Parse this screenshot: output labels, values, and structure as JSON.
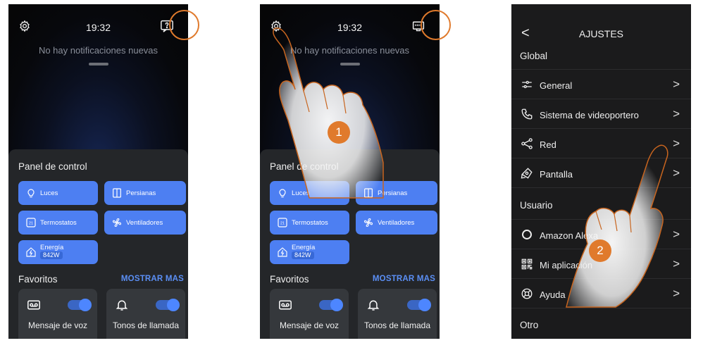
{
  "screen": {
    "time": "19:32",
    "notifications": "No hay notificaciones nuevas",
    "panel_title": "Panel de control",
    "tiles": {
      "lights": "Luces",
      "blinds": "Persianas",
      "thermostats": "Termostatos",
      "fans": "Ventiladores",
      "energy": "Energía",
      "energy_value": "842W"
    },
    "favorites_title": "Favoritos",
    "show_more": "MOSTRAR MAS",
    "favorites": {
      "voice_message": "Mensaje de voz",
      "ringtones": "Tonos de llamada"
    }
  },
  "steps": {
    "one": "1",
    "two": "2"
  },
  "settings": {
    "title": "AJUSTES",
    "back": "<",
    "sections": {
      "global": "Global",
      "user": "Usuario",
      "other": "Otro"
    },
    "items": {
      "general": "General",
      "intercom": "Sistema de videoportero",
      "network": "Red",
      "display": "Pantalla",
      "alexa": "Amazon Alexa",
      "myapp": "Mi aplicación",
      "help": "Ayuda"
    },
    "chevron": ">"
  },
  "colors": {
    "accent": "#4d7ff2",
    "highlight": "#e07a2c",
    "link": "#5b8ff5"
  },
  "icons": [
    "gear-icon",
    "notification-icon",
    "network-status-icon",
    "bulb-icon",
    "blinds-icon",
    "thermostat-icon",
    "fan-icon",
    "energy-icon",
    "voicemail-icon",
    "bell-icon",
    "sliders-icon",
    "phone-icon",
    "share-icon",
    "display-icon",
    "alexa-icon",
    "qr-icon",
    "help-icon"
  ]
}
